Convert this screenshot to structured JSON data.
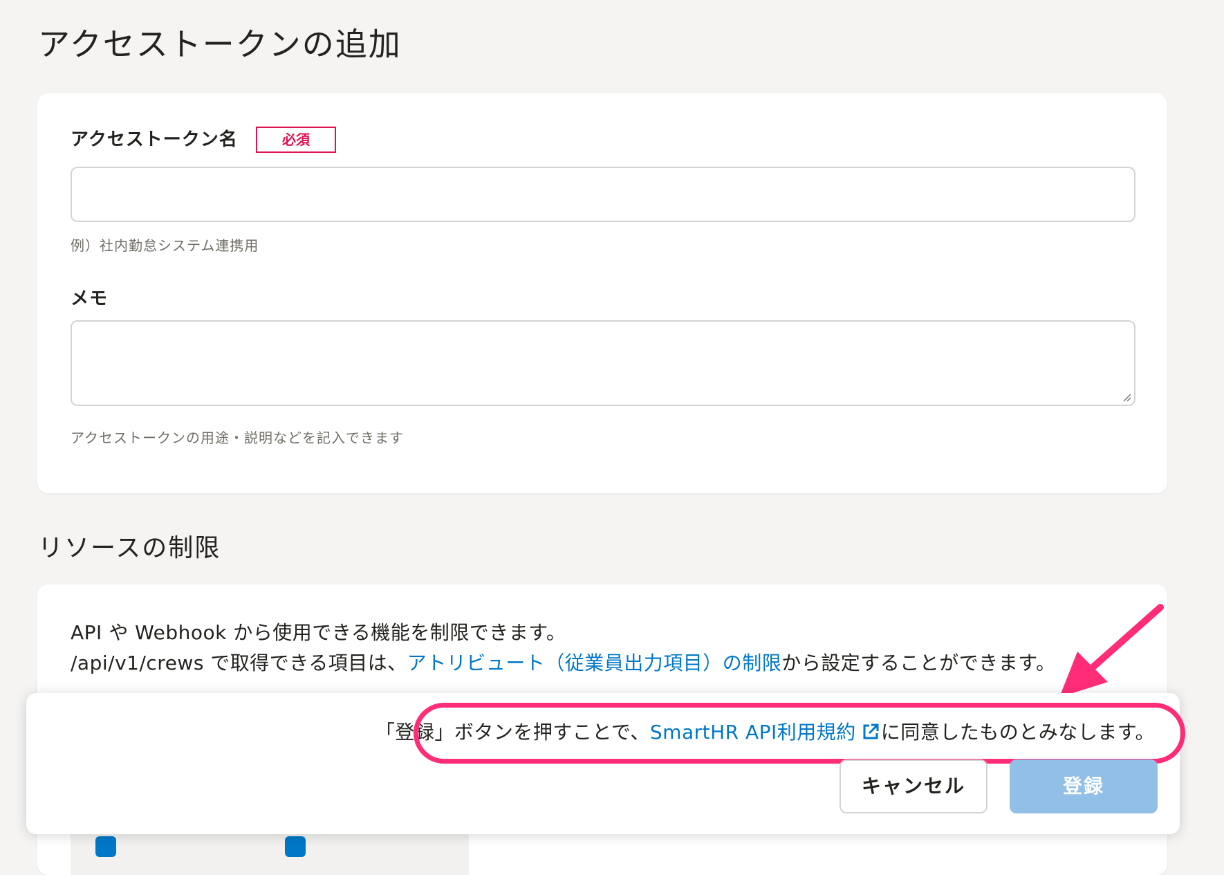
{
  "page": {
    "title": "アクセストークンの追加"
  },
  "form": {
    "name_label": "アクセストークン名",
    "required_badge": "必須",
    "name_value": "",
    "name_help": "例）社内勤怠システム連携用",
    "memo_label": "メモ",
    "memo_value": "",
    "memo_help": "アクセストークンの用途・説明などを記入できます"
  },
  "resource": {
    "section_title": "リソースの制限",
    "line1": "API や Webhook から使用できる機能を制限できます。",
    "line2_prefix": "/api/v1/crews で取得できる項目は、",
    "line2_link": "アトリビュート（従業員出力項目）の制限",
    "line2_suffix": "から設定することができます。"
  },
  "footer": {
    "agreement_prefix": "「登録」ボタンを押すことで、",
    "agreement_link": "SmartHR API利用規約",
    "agreement_suffix": "に同意したものとみなします。",
    "cancel_label": "キャンセル",
    "register_label": "登録"
  },
  "colors": {
    "accent": "#0077c7",
    "required": "#e0124f",
    "annotation": "#ff2d78",
    "register_disabled": "#92bfe6"
  },
  "icons": {
    "external_link": "external-link-icon",
    "annotation_arrow": "arrow-icon"
  }
}
